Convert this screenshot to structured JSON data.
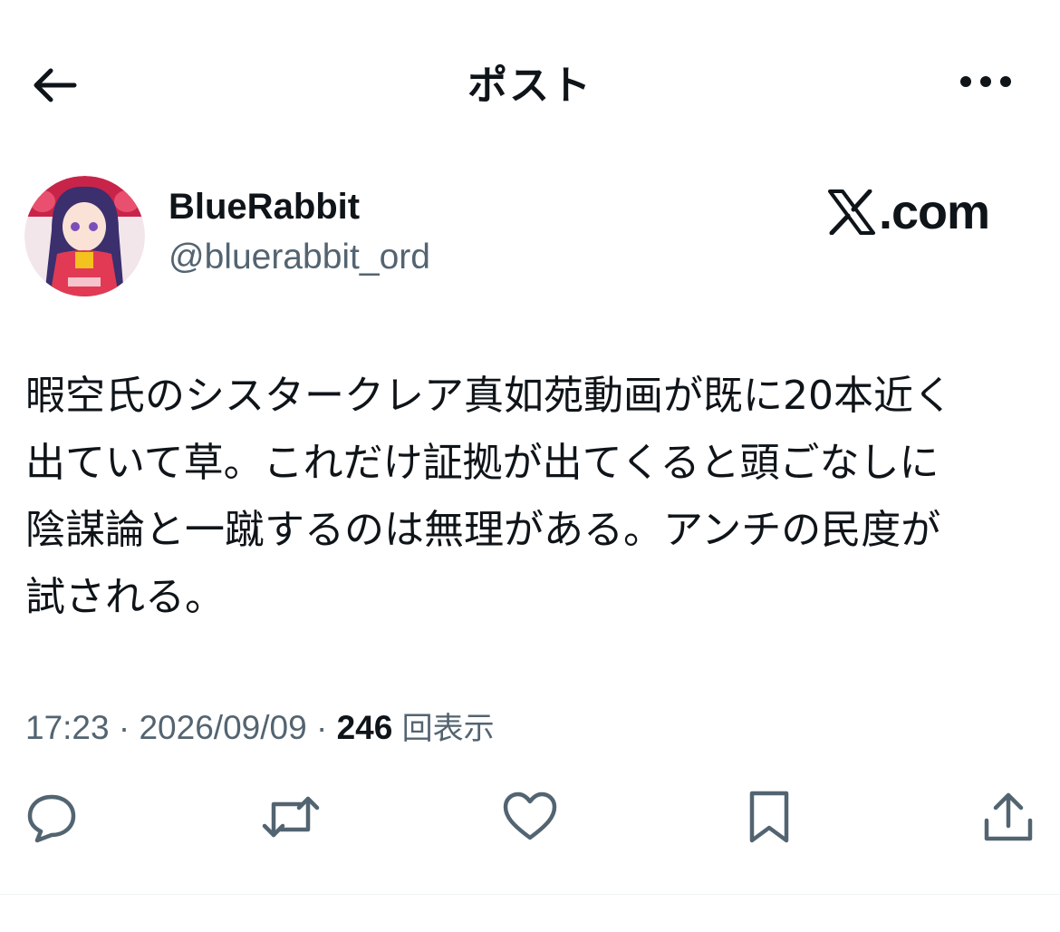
{
  "header": {
    "back_icon": "arrow-left-icon",
    "title": "ポスト",
    "more_icon": "more-horizontal-icon"
  },
  "author": {
    "display_name": "BlueRabbit",
    "handle": "@bluerabbit_ord",
    "avatar_icon": "avatar-image"
  },
  "watermark": {
    "text": ".com",
    "logo_icon": "x-logo-icon"
  },
  "post": {
    "lines": [
      "暇空氏のシスタークレア真如苑動画が既に20本近く",
      "出ていて草。これだけ証拠が出てくると頭ごなしに",
      "陰謀論と一蹴するのは無理がある。アンチの民度が",
      "試される。"
    ]
  },
  "meta": {
    "time": "17:23",
    "separator": " · ",
    "date": "2026/09/09",
    "views_count": "246",
    "views_label": "回表示"
  },
  "actions": [
    {
      "name": "reply",
      "icon": "reply-icon"
    },
    {
      "name": "repost",
      "icon": "repost-icon"
    },
    {
      "name": "like",
      "icon": "heart-icon"
    },
    {
      "name": "bookmark",
      "icon": "bookmark-icon"
    },
    {
      "name": "share",
      "icon": "share-icon"
    }
  ],
  "colors": {
    "text_primary": "#0f1419",
    "text_secondary": "#536471",
    "divider": "#eff3f4"
  }
}
